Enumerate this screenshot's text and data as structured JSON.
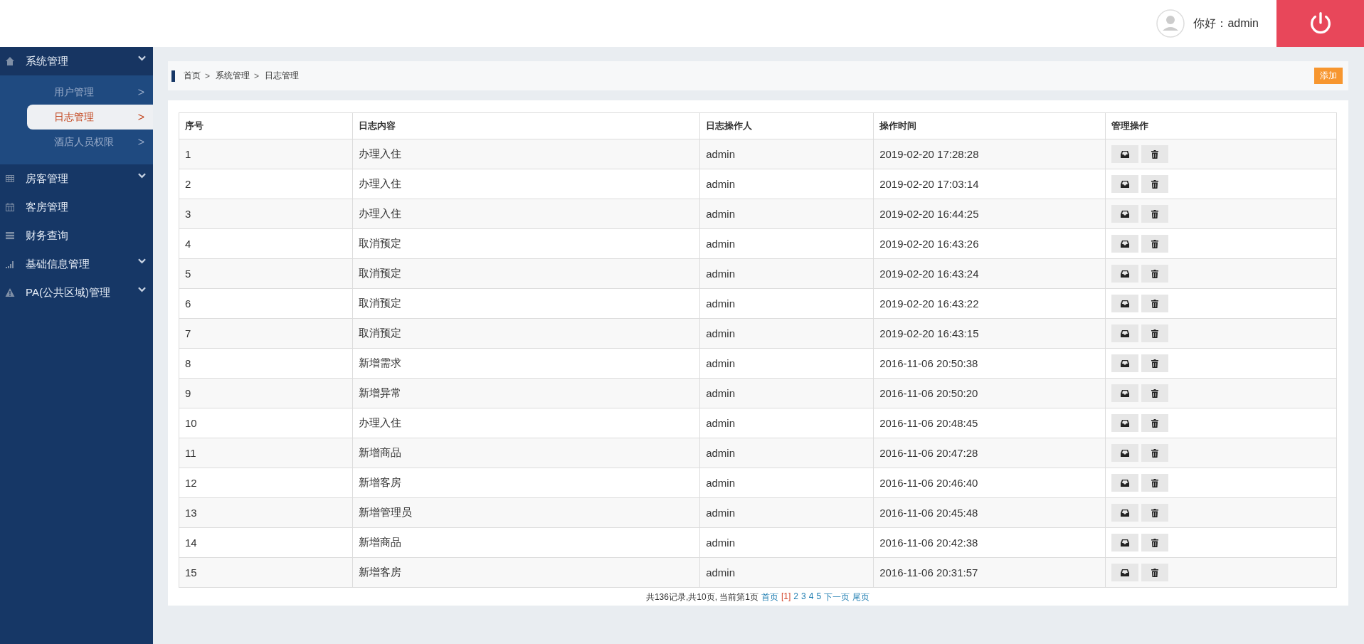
{
  "header": {
    "greeting": "你好：admin"
  },
  "sidebar": {
    "items": [
      {
        "label": "系统管理",
        "expandable": true,
        "expanded": true,
        "children": [
          {
            "label": "用户管理",
            "arrow": ">",
            "selected": false
          },
          {
            "label": "日志管理",
            "arrow": ">",
            "selected": true
          },
          {
            "label": "酒店人员权限",
            "arrow": ">",
            "selected": false
          }
        ]
      },
      {
        "label": "房客管理",
        "expandable": true,
        "expanded": false
      },
      {
        "label": "客房管理",
        "expandable": false,
        "expanded": false
      },
      {
        "label": "财务查询",
        "expandable": false,
        "expanded": false
      },
      {
        "label": "基础信息管理",
        "expandable": true,
        "expanded": false
      },
      {
        "label": "PA(公共区域)管理",
        "expandable": true,
        "expanded": false
      }
    ]
  },
  "breadcrumb": [
    "首页",
    "系统管理",
    "日志管理"
  ],
  "breadcrumb_separator": ">",
  "add_button": "添加",
  "table": {
    "columns": [
      "序号",
      "日志内容",
      "日志操作人",
      "操作时间",
      "管理操作"
    ],
    "rows": [
      [
        "1",
        "办理入住",
        "admin",
        "2019-02-20 17:28:28"
      ],
      [
        "2",
        "办理入住",
        "admin",
        "2019-02-20 17:03:14"
      ],
      [
        "3",
        "办理入住",
        "admin",
        "2019-02-20 16:44:25"
      ],
      [
        "4",
        "取消预定",
        "admin",
        "2019-02-20 16:43:26"
      ],
      [
        "5",
        "取消预定",
        "admin",
        "2019-02-20 16:43:24"
      ],
      [
        "6",
        "取消预定",
        "admin",
        "2019-02-20 16:43:22"
      ],
      [
        "7",
        "取消预定",
        "admin",
        "2019-02-20 16:43:15"
      ],
      [
        "8",
        "新增需求",
        "admin",
        "2016-11-06 20:50:38"
      ],
      [
        "9",
        "新增异常",
        "admin",
        "2016-11-06 20:50:20"
      ],
      [
        "10",
        "办理入住",
        "admin",
        "2016-11-06 20:48:45"
      ],
      [
        "11",
        "新增商品",
        "admin",
        "2016-11-06 20:47:28"
      ],
      [
        "12",
        "新增客房",
        "admin",
        "2016-11-06 20:46:40"
      ],
      [
        "13",
        "新增管理员",
        "admin",
        "2016-11-06 20:45:48"
      ],
      [
        "14",
        "新增商品",
        "admin",
        "2016-11-06 20:42:38"
      ],
      [
        "15",
        "新增客房",
        "admin",
        "2016-11-06 20:31:57"
      ]
    ]
  },
  "pagination": {
    "summary": "共136记录,共10页, 当前第1页",
    "links": [
      {
        "label": "首页",
        "selected": false
      },
      {
        "label": "[1]",
        "selected": true
      },
      {
        "label": "2",
        "selected": false
      },
      {
        "label": "3",
        "selected": false
      },
      {
        "label": "4",
        "selected": false
      },
      {
        "label": "5",
        "selected": false
      },
      {
        "label": "下一页",
        "selected": false
      },
      {
        "label": "尾页",
        "selected": false
      }
    ]
  }
}
